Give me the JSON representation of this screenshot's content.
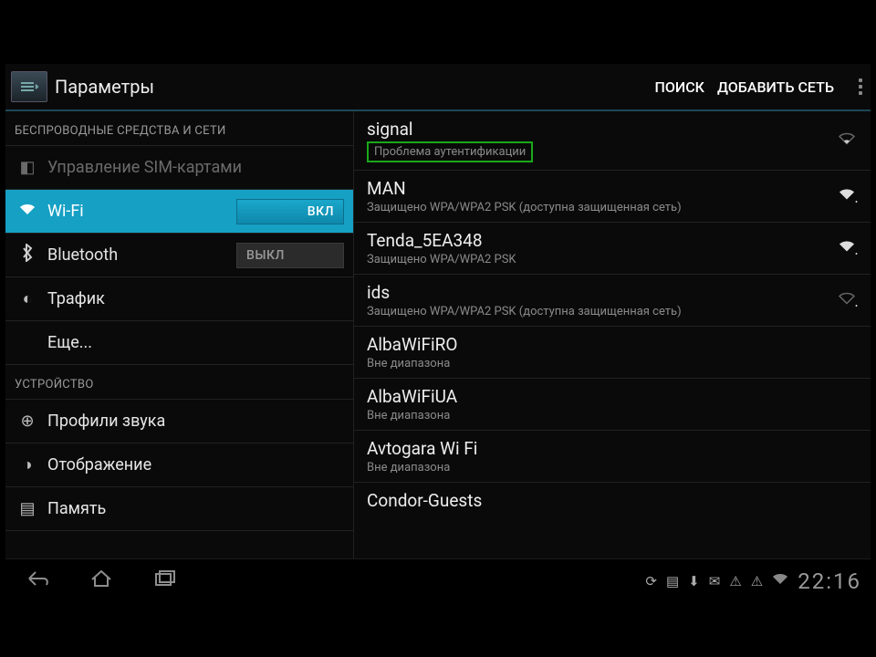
{
  "header": {
    "title": "Параметры",
    "search_label": "ПОИСК",
    "add_network_label": "ДОБАВИТЬ СЕТЬ"
  },
  "sidebar": {
    "section_wireless": "БЕСПРОВОДНЫЕ СРЕДСТВА И СЕТИ",
    "section_device": "УСТРОЙСТВО",
    "items": [
      {
        "label": "Управление SIM-картами",
        "icon": "sim-icon"
      },
      {
        "label": "Wi-Fi",
        "icon": "wifi-icon",
        "toggle": "ВКЛ"
      },
      {
        "label": "Bluetooth",
        "icon": "bluetooth-icon",
        "toggle": "ВЫКЛ"
      },
      {
        "label": "Трафик",
        "icon": "data-usage-icon"
      },
      {
        "label": "Еще...",
        "icon": ""
      },
      {
        "label": "Профили звука",
        "icon": "sound-icon"
      },
      {
        "label": "Отображение",
        "icon": "display-icon"
      },
      {
        "label": "Память",
        "icon": "storage-icon"
      }
    ]
  },
  "wifi_list": [
    {
      "name": "signal",
      "sub": "Проблема аутентификации",
      "signal": "weak"
    },
    {
      "name": "MAN",
      "sub": "Защищено WPA/WPA2 PSK (доступна защищенная сеть)",
      "signal": "strong",
      "locked": true
    },
    {
      "name": "Tenda_5EA348",
      "sub": "Защищено WPA/WPA2 PSK",
      "signal": "strong",
      "locked": true
    },
    {
      "name": "ids",
      "sub": "Защищено WPA/WPA2 PSK (доступна защищенная сеть)",
      "signal": "weak",
      "locked": true
    },
    {
      "name": "AlbaWiFiRO",
      "sub": "Вне диапазона"
    },
    {
      "name": "AlbaWiFiUA",
      "sub": "Вне диапазона"
    },
    {
      "name": "Avtogara Wi Fi",
      "sub": "Вне диапазона"
    },
    {
      "name": "Condor-Guests",
      "sub": ""
    }
  ],
  "statusbar": {
    "time": "22:16"
  }
}
